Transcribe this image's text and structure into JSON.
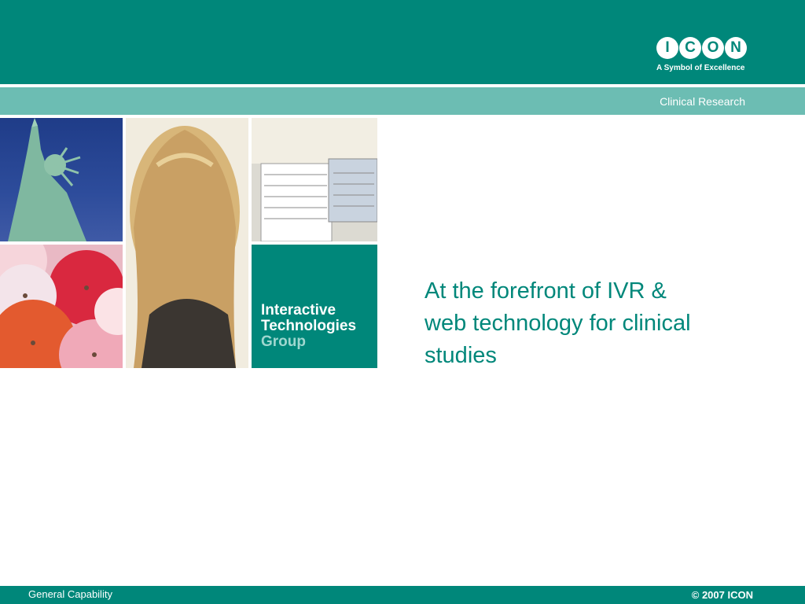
{
  "header": {
    "logo_letters": [
      "I",
      "C",
      "O",
      "N"
    ],
    "logo_tagline": "A Symbol of Excellence",
    "sub_tagline": "Clinical Research"
  },
  "collage": {
    "group_label_line1": "Interactive",
    "group_label_line2": "Technologies",
    "group_label_line3": "Group"
  },
  "main": {
    "headline_line1": "At the forefront of IVR &",
    "headline_line2": "web technology for clinical",
    "headline_line3": "studies"
  },
  "footer": {
    "left_text": "General Capability",
    "right_text": "© 2007 ICON"
  },
  "colors": {
    "brand_teal": "#00877a",
    "stripe_teal": "#6cbdb3",
    "light_teal_text": "#9fd7cf"
  }
}
